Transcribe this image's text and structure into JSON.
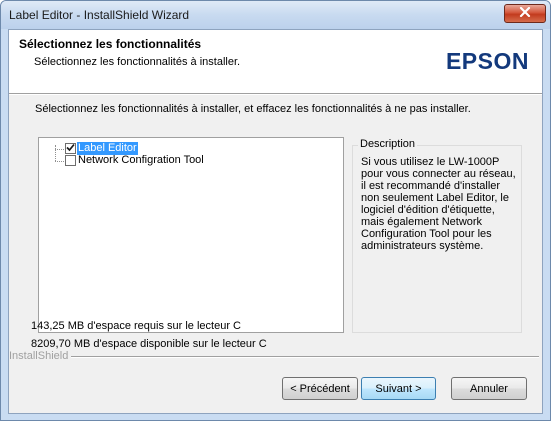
{
  "window": {
    "title": "Label Editor - InstallShield Wizard"
  },
  "header": {
    "title": "Sélectionnez les fonctionnalités",
    "subtitle": "Sélectionnez les fonctionnalités à installer.",
    "logo_text": "EPSON",
    "logo_color": "#13397c"
  },
  "instructions": "Sélectionnez les fonctionnalités à installer, et effacez les fonctionnalités à ne pas installer.",
  "features": [
    {
      "label": "Label Editor",
      "checked": true,
      "selected": true
    },
    {
      "label": "Network Configration Tool",
      "checked": false,
      "selected": false
    }
  ],
  "description": {
    "legend": "Description",
    "text": "Si vous utilisez le LW-1000P pour vous connecter au réseau, il est recommandé d'installer non seulement Label Editor, le logiciel d'édition d'étiquette, mais également Network Configuration Tool pour les administrateurs système."
  },
  "disk": {
    "required": "143,25 MB d'espace requis sur le lecteur C",
    "available": "8209,70 MB d'espace disponible sur le lecteur C"
  },
  "brand": "InstallShield",
  "buttons": {
    "back": "< Précédent",
    "next": "Suivant >",
    "cancel": "Annuler"
  },
  "icons": {
    "close": "close-icon",
    "check": "checkmark-icon"
  },
  "colors": {
    "selection": "#3399ff",
    "close_button": "#c9452a"
  }
}
